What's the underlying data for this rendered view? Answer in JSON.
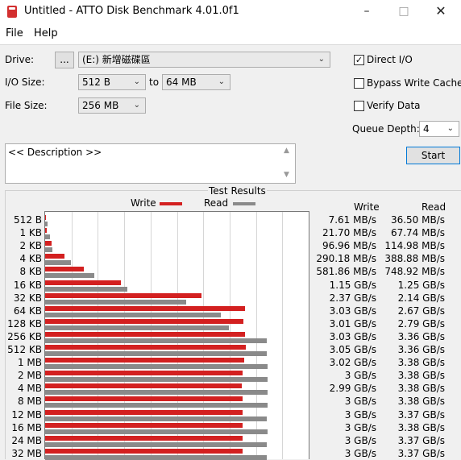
{
  "window": {
    "title": "Untitled - ATTO Disk Benchmark 4.01.0f1",
    "minimize": "–",
    "maximize": "□",
    "close": "✕"
  },
  "menu": {
    "file": "File",
    "help": "Help"
  },
  "controls": {
    "drive_label": "Drive:",
    "browse": "...",
    "drive_value": "(E:) 新增磁碟區",
    "io_size_label": "I/O Size:",
    "io_from": "512 B",
    "to_label": "to",
    "io_to": "64 MB",
    "file_size_label": "File Size:",
    "file_size": "256 MB",
    "direct_io": {
      "label": "Direct I/O",
      "checked": true
    },
    "bypass_write_cache": {
      "label": "Bypass Write Cache",
      "checked": false
    },
    "verify_data": {
      "label": "Verify Data",
      "checked": false
    },
    "queue_depth_label": "Queue Depth:",
    "queue_depth": "4",
    "start": "Start",
    "description": "<< Description >>"
  },
  "chart_data": {
    "type": "bar",
    "title": "Test Results",
    "x_unit": "GB/s",
    "xlim": [
      0,
      4
    ],
    "grid": true,
    "legend_placement": "top",
    "series": [
      {
        "name": "Write",
        "color": "#d32020",
        "values": [
          0.0076,
          0.0217,
          0.097,
          0.29,
          0.582,
          1.15,
          2.37,
          3.03,
          3.01,
          3.03,
          3.05,
          3.02,
          3.0,
          2.99,
          3.0,
          3.0,
          3.0,
          3.0,
          3.0
        ]
      },
      {
        "name": "Read",
        "color": "#8a8a8a",
        "values": [
          0.0365,
          0.0677,
          0.115,
          0.389,
          0.749,
          1.25,
          2.14,
          2.67,
          2.79,
          3.36,
          3.36,
          3.38,
          3.38,
          3.38,
          3.38,
          3.37,
          3.38,
          3.37,
          3.37
        ]
      }
    ],
    "categories": [
      "512 B",
      "1 KB",
      "2 KB",
      "4 KB",
      "8 KB",
      "16 KB",
      "32 KB",
      "64 KB",
      "128 KB",
      "256 KB",
      "512 KB",
      "1 MB",
      "2 MB",
      "4 MB",
      "8 MB",
      "12 MB",
      "16 MB",
      "24 MB",
      "32 MB"
    ],
    "write_header": "Write",
    "read_header": "Read",
    "write_text": [
      "7.61 MB/s",
      "21.70 MB/s",
      "96.96 MB/s",
      "290.18 MB/s",
      "581.86 MB/s",
      "1.15 GB/s",
      "2.37 GB/s",
      "3.03 GB/s",
      "3.01 GB/s",
      "3.03 GB/s",
      "3.05 GB/s",
      "3.02 GB/s",
      "3 GB/s",
      "2.99 GB/s",
      "3 GB/s",
      "3 GB/s",
      "3 GB/s",
      "3 GB/s",
      "3 GB/s"
    ],
    "read_text": [
      "36.50 MB/s",
      "67.74 MB/s",
      "114.98 MB/s",
      "388.88 MB/s",
      "748.92 MB/s",
      "1.25 GB/s",
      "2.14 GB/s",
      "2.67 GB/s",
      "2.79 GB/s",
      "3.36 GB/s",
      "3.36 GB/s",
      "3.38 GB/s",
      "3.38 GB/s",
      "3.38 GB/s",
      "3.38 GB/s",
      "3.37 GB/s",
      "3.38 GB/s",
      "3.37 GB/s",
      "3.37 GB/s"
    ]
  }
}
